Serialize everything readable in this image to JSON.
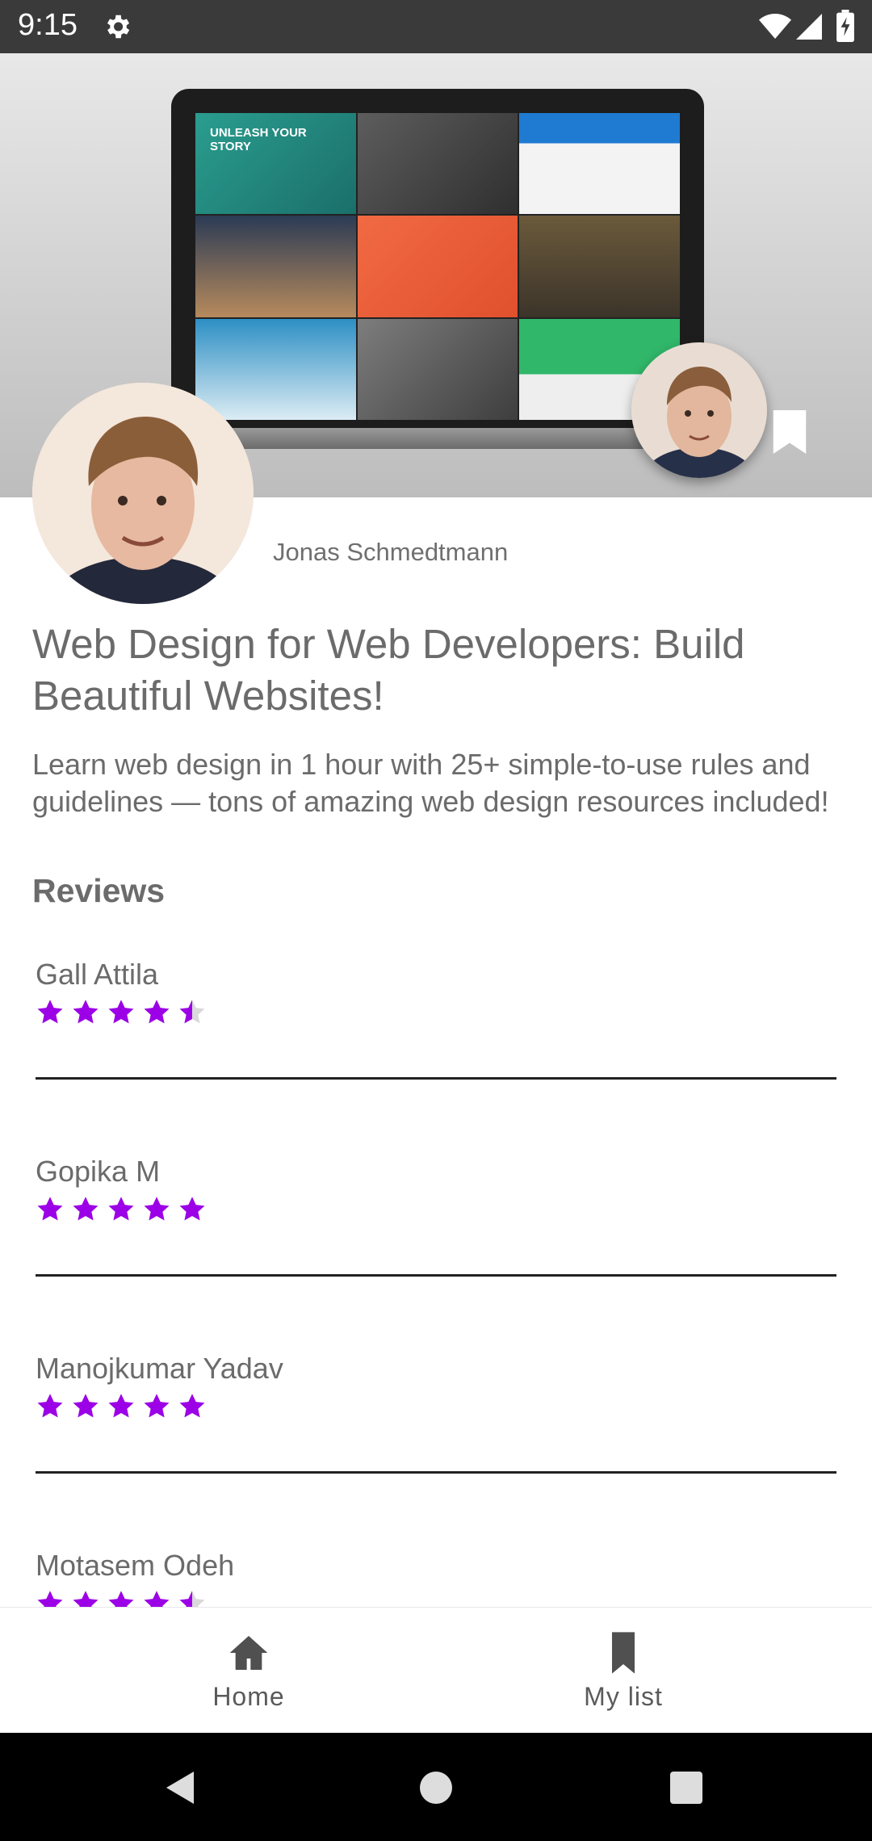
{
  "status_bar": {
    "time": "9:15"
  },
  "author": {
    "name": "Jonas Schmedtmann"
  },
  "course": {
    "title": "Web Design for Web Developers: Build Beautiful Websites!",
    "description": "Learn web design in 1 hour with 25+ simple-to-use rules and guidelines — tons of amazing web design resources included!",
    "hero_text": "UNLEASH YOUR STORY"
  },
  "reviews": {
    "heading": "Reviews",
    "items": [
      {
        "name": "Gall Attila",
        "rating": 4.5
      },
      {
        "name": "Gopika M",
        "rating": 5
      },
      {
        "name": "Manojkumar Yadav",
        "rating": 5
      },
      {
        "name": "Motasem Odeh",
        "rating": 4.5
      }
    ]
  },
  "bottom_nav": {
    "home_label": "Home",
    "my_list_label": "My list"
  },
  "colors": {
    "star": "#9c00e6",
    "star_empty": "#d9d9d9",
    "text": "#6b6b6b",
    "status_bar": "#3a3a3a"
  }
}
